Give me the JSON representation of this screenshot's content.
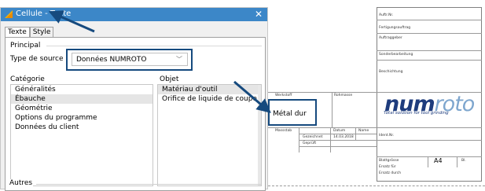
{
  "dialog": {
    "title": "Cellule - Texte",
    "close_glyph": "✕",
    "tabs": [
      {
        "label": "Texte",
        "active": true
      },
      {
        "label": "Style",
        "active": false
      }
    ],
    "principal": {
      "group_label": "Principal",
      "source_label": "Type de source",
      "source_value": "Données NUMROTO"
    },
    "categorie": {
      "label": "Catégorie",
      "items": [
        "Généralités",
        "Ébauche",
        "Géométrie",
        "Options du programme",
        "Données du client"
      ],
      "selected_index": 1
    },
    "objet": {
      "label": "Objet",
      "items": [
        "Matériau d'outil",
        "Orifice de liquide de coupe"
      ],
      "selected_index": 0
    },
    "autres": {
      "label": "Autres"
    }
  },
  "drawing": {
    "labels": {
      "auftrag_nr": "Auftr.Nr.",
      "fertigungsauftrag": "Fertigungsauftrag",
      "auftraggeber": "Auftraggeber",
      "sonderbearbeitung": "Sonderbearbeitung",
      "beschichtung": "Beschichtung",
      "werkstoff": "Werkstoff",
      "rohmasse": "Rohmasse",
      "massstab": "Massstab",
      "datum": "Datum",
      "name": "Name",
      "gezeichnet": "Gezeichnet",
      "geprueft": "Geprüft",
      "date_value": "14.03.2018",
      "ident_nr": "Ident.Nr.",
      "blattgroesse": "Blattgrösse",
      "blattgroesse_value": "A4",
      "bl": "Bl.",
      "ersatz_fuer": "Ersatz für",
      "ersatz_durch": "Ersatz durch"
    },
    "metal_value": "Métal dur",
    "logo": {
      "part1": "num",
      "part2": "roto",
      "tagline": "Total solution for tool grinding"
    }
  },
  "colors": {
    "titlebar": "#3c87c8",
    "highlight": "#164a7e",
    "logo_dark": "#1e3c7d",
    "logo_light": "#7ea6ce"
  }
}
